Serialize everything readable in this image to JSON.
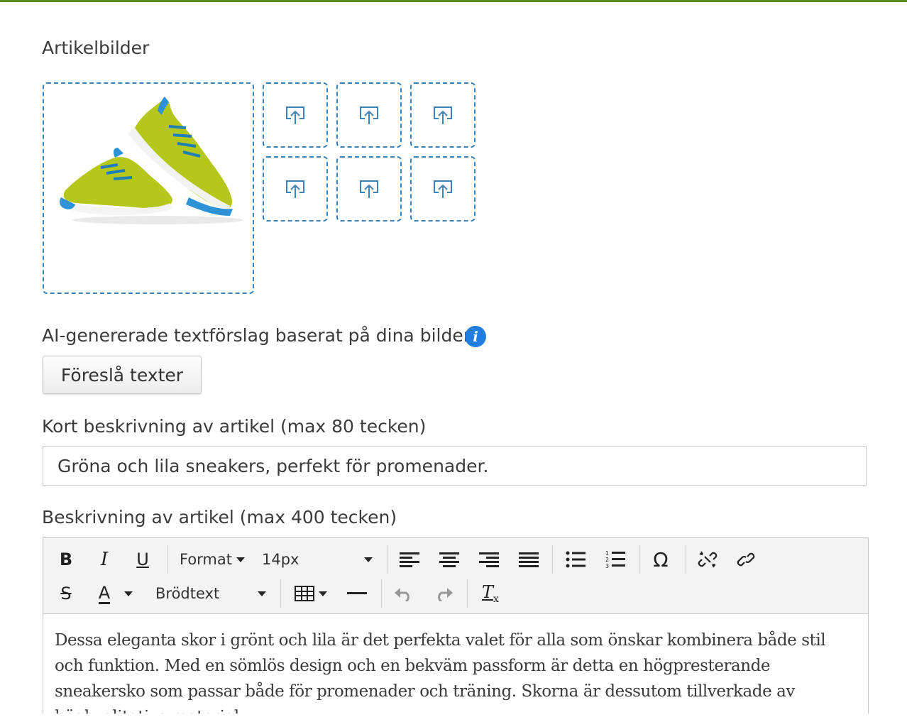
{
  "images_section": {
    "label": "Artikelbilder",
    "main_image_alt": "Gröna sneakers",
    "upload_slot_count": 6
  },
  "ai_section": {
    "label": "AI-genererade textförslag baserat på dina bilder",
    "info_icon": "info-icon",
    "suggest_button_label": "Föreslå texter"
  },
  "short_description": {
    "label": "Kort beskrivning av artikel (max 80 tecken)",
    "value": "Gröna och lila sneakers, perfekt för promenader."
  },
  "description": {
    "label": "Beskrivning av artikel (max 400 tecken)",
    "toolbar": {
      "format_label": "Format",
      "font_size_value": "14px",
      "paragraph_style_value": "Brödtext"
    },
    "text": "Dessa eleganta skor i grönt och lila är det perfekta valet för alla som önskar kombinera både stil och funktion. Med en sömlös design och en bekväm passform är detta en högpresterande sneakersko som passar både för promenader och träning. Skorna är dessutom tillverkade av högkvalitativa material"
  },
  "colors": {
    "accent_blue": "#3a82b8",
    "info_blue": "#1f7ee0",
    "top_border_green": "#5a8a1e",
    "shoe_green": "#b5c71a"
  }
}
